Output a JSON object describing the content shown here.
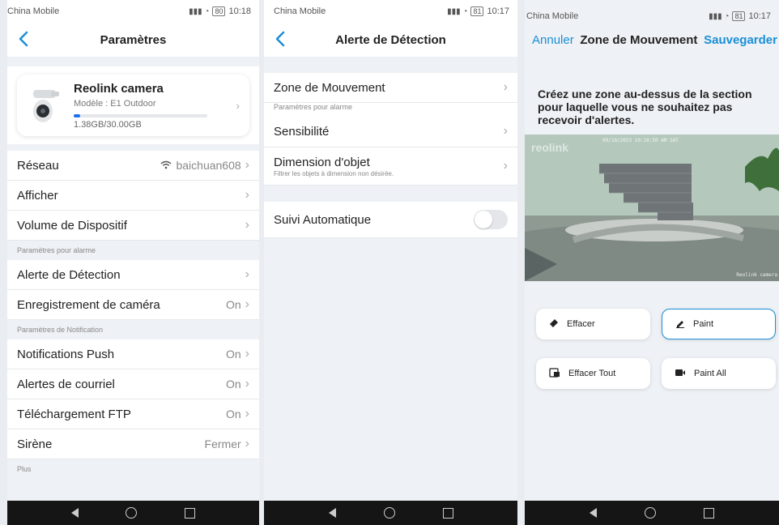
{
  "panels": [
    {
      "status": {
        "carrier": "China Mobile",
        "time": "10:18",
        "battery": "80"
      },
      "title": "Paramètres",
      "camera": {
        "name": "Reolink camera",
        "model": "Modèle : E1 Outdoor",
        "storage": "1.38GB/30.00GB",
        "storage_fraction": 0.046
      },
      "rows_a": [
        {
          "label": "Réseau",
          "value": "baichuan608"
        },
        {
          "label": "Afficher",
          "value": ""
        },
        {
          "label": "Volume de Dispositif",
          "value": ""
        }
      ],
      "section_alarm": "Paramètres pour alarme",
      "rows_b": [
        {
          "label": "Alerte de Détection",
          "value": ""
        },
        {
          "label": "Enregistrement de caméra",
          "value": "On"
        }
      ],
      "section_notif": "Paramètres de Notification",
      "rows_c": [
        {
          "label": "Notifications Push",
          "value": "On"
        },
        {
          "label": "Alertes de courriel",
          "value": "On"
        },
        {
          "label": "Téléchargement FTP",
          "value": "On"
        },
        {
          "label": "Sirène",
          "value": "Fermer"
        }
      ],
      "section_more": "Plus"
    },
    {
      "status": {
        "carrier": "China Mobile",
        "time": "10:17",
        "battery": "81"
      },
      "title": "Alerte de Détection",
      "zone": "Zone de Mouvement",
      "section_alarm": "Paramètres pour alarme",
      "sensitivity": "Sensibilité",
      "object_size": "Dimension d'objet",
      "object_size_sub": "Filtrer les objets à dimension non désirée.",
      "auto_track": "Suivi Automatique",
      "auto_track_on": false
    },
    {
      "status": {
        "carrier": "China Mobile",
        "time": "10:17",
        "battery": "81"
      },
      "cancel": "Annuler",
      "title": "Zone de Mouvement",
      "save": "Sauvegarder",
      "instruction": "Créez une zone au-dessus de la section pour laquelle vous ne souhaitez pas recevoir d'alertes.",
      "video": {
        "watermark": "reolink",
        "timestamp": "09/18/2023 10:18:50 AM SAT",
        "brand_bottom": "Reolink camera"
      },
      "buttons": {
        "erase": "Effacer",
        "paint": "Paint",
        "erase_all": "Effacer Tout",
        "paint_all": "Paint All"
      },
      "selected_tool": "Paint"
    }
  ],
  "icons": [
    "back-chevron-icon",
    "wifi-icon",
    "chevron-right-icon",
    "eraser-icon",
    "pencil-icon",
    "erase-all-icon",
    "paint-all-icon"
  ],
  "colors": {
    "accent": "#1a8fd6",
    "progress": "#1a73e8",
    "background": "#eef1f5"
  }
}
